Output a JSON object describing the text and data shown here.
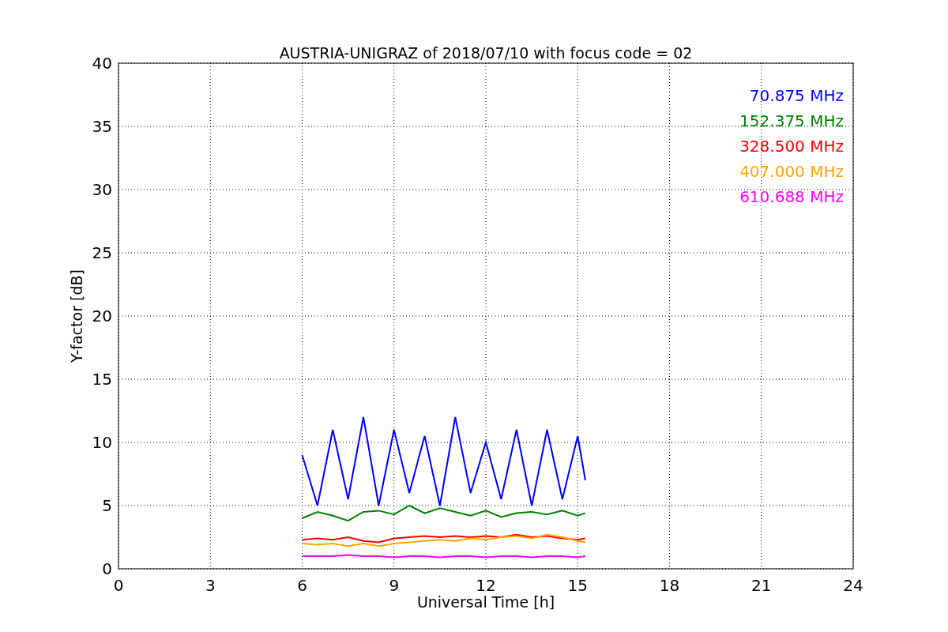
{
  "chart_data": {
    "type": "line",
    "title": "AUSTRIA-UNIGRAZ of 2018/07/10 with focus code = 02",
    "xlabel": "Universal Time [h]",
    "ylabel": "Y-factor [dB]",
    "x": [
      6,
      6.5,
      7,
      7.5,
      8,
      8.5,
      9,
      9.5,
      10,
      10.5,
      11,
      11.5,
      12,
      12.5,
      13,
      13.5,
      14,
      14.5,
      15,
      15.25
    ],
    "series": [
      {
        "name": "70.875 MHz",
        "color": "#0000ff",
        "values": [
          9,
          5,
          11,
          5.5,
          12,
          5,
          11,
          6,
          10.5,
          5,
          12,
          6,
          10,
          5.5,
          11,
          5,
          11,
          5.5,
          10.5,
          7
        ]
      },
      {
        "name": "152.375 MHz",
        "color": "#008000",
        "values": [
          4,
          4.5,
          4.2,
          3.8,
          4.5,
          4.6,
          4.3,
          5,
          4.4,
          4.8,
          4.5,
          4.2,
          4.6,
          4.1,
          4.4,
          4.5,
          4.3,
          4.6,
          4.2,
          4.4
        ]
      },
      {
        "name": "328.500 MHz",
        "color": "#ff0000",
        "values": [
          2.3,
          2.4,
          2.3,
          2.5,
          2.2,
          2.1,
          2.4,
          2.5,
          2.6,
          2.5,
          2.6,
          2.5,
          2.6,
          2.5,
          2.7,
          2.5,
          2.6,
          2.4,
          2.3,
          2.4
        ]
      },
      {
        "name": "407.000 MHz",
        "color": "#ffa500",
        "values": [
          2,
          1.9,
          2,
          1.8,
          2,
          1.8,
          2,
          2.1,
          2.2,
          2.3,
          2.2,
          2.4,
          2.3,
          2.5,
          2.6,
          2.4,
          2.7,
          2.5,
          2.2,
          2.1
        ]
      },
      {
        "name": "610.688 MHz",
        "color": "#ff00ff",
        "values": [
          1,
          1,
          1,
          1.1,
          1,
          1,
          0.9,
          1,
          1,
          0.9,
          1,
          1,
          0.9,
          1,
          1,
          0.9,
          1,
          1,
          0.9,
          1
        ]
      }
    ],
    "xlim": [
      0,
      24
    ],
    "ylim": [
      0,
      40
    ],
    "xticks": [
      0,
      3,
      6,
      9,
      12,
      15,
      18,
      21,
      24
    ],
    "yticks": [
      0,
      5,
      10,
      15,
      20,
      25,
      30,
      35,
      40
    ],
    "grid": true
  }
}
